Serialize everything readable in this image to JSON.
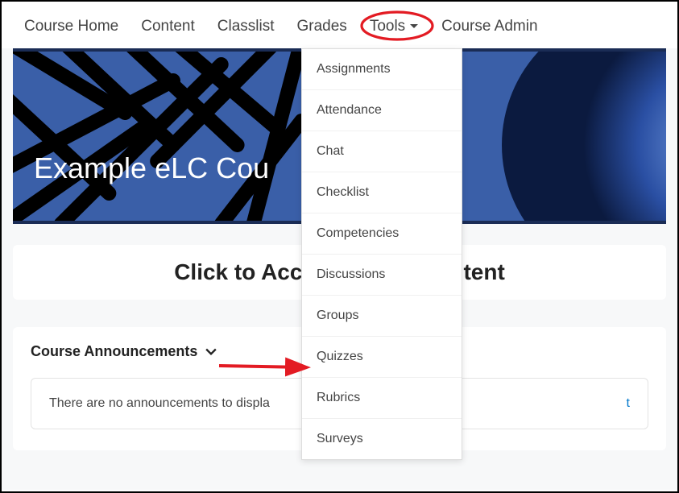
{
  "nav": {
    "items": [
      {
        "label": "Course Home"
      },
      {
        "label": "Content"
      },
      {
        "label": "Classlist"
      },
      {
        "label": "Grades"
      },
      {
        "label": "Tools"
      },
      {
        "label": "Course Admin"
      }
    ]
  },
  "tools_menu": {
    "items": [
      {
        "label": "Assignments"
      },
      {
        "label": "Attendance"
      },
      {
        "label": "Chat"
      },
      {
        "label": "Checklist"
      },
      {
        "label": "Competencies"
      },
      {
        "label": "Discussions"
      },
      {
        "label": "Groups"
      },
      {
        "label": "Quizzes"
      },
      {
        "label": "Rubrics"
      },
      {
        "label": "Surveys"
      }
    ]
  },
  "banner": {
    "title_visible": "Example eLC Cou"
  },
  "access_card": {
    "heading_left": "Click to Acc",
    "heading_right": "tent"
  },
  "announcements": {
    "header": "Course Announcements",
    "empty_text_visible": "There are no announcements to displa",
    "link_scrap": "t"
  },
  "annotation": {
    "highlight_color": "#e31b23",
    "arrow_color": "#e31b23"
  }
}
